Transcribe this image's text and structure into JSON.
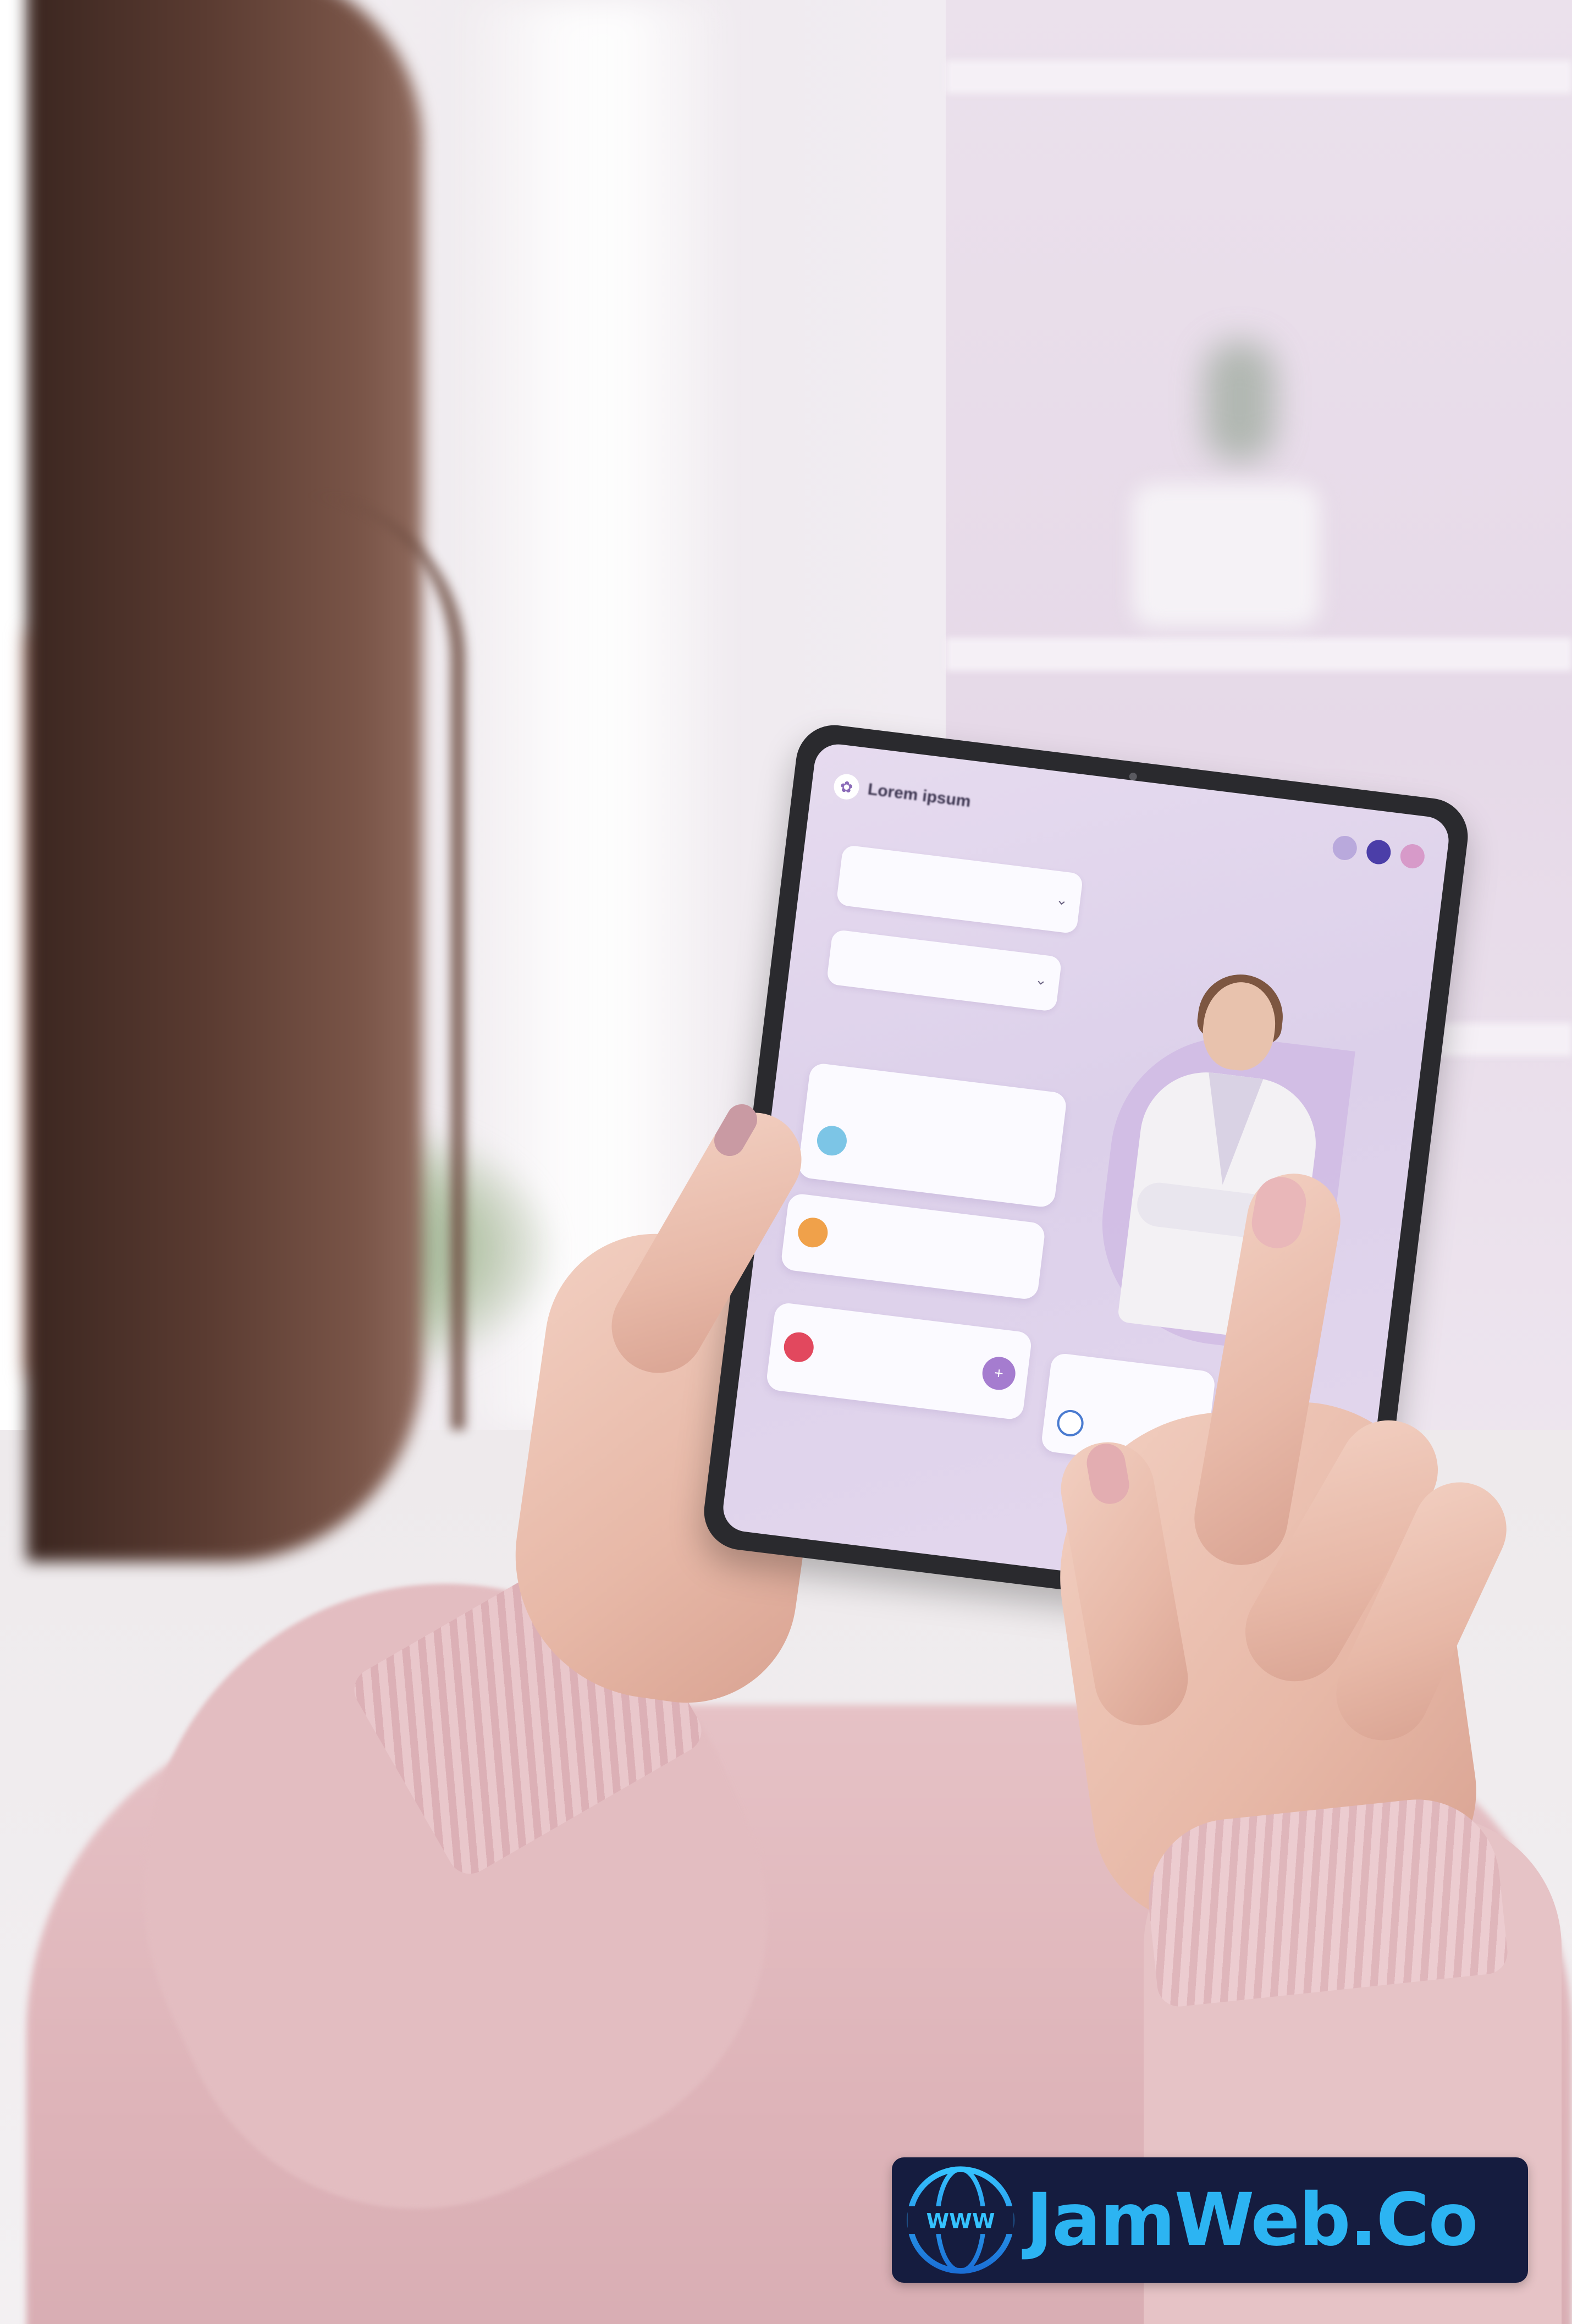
{
  "scene": {
    "description_colors": {
      "sweater": "#e3bdc1",
      "tablet_screen": "#e2d6ee",
      "accent": "#a57ccf"
    }
  },
  "tablet_app": {
    "title": "Lorem ipsum",
    "header_icons": [
      "profile-icon",
      "notification-icon",
      "settings-icon"
    ],
    "section1_label": "",
    "field1": {
      "title": "",
      "subtitle": ""
    },
    "field2_label": "",
    "field2": {
      "value": ""
    },
    "chips_label": "",
    "chips": [
      "",
      "",
      ""
    ],
    "card1": {
      "title": "",
      "action": "",
      "text": ""
    },
    "card2": {
      "text": ""
    },
    "section2_label": "",
    "card3": {
      "text": ""
    },
    "card4": {
      "title": ""
    }
  },
  "watermark": {
    "text": "JamWeb.Co",
    "globe_text": "WWW",
    "bg_color": "#151c3f",
    "text_color": "#2cb4f2"
  }
}
